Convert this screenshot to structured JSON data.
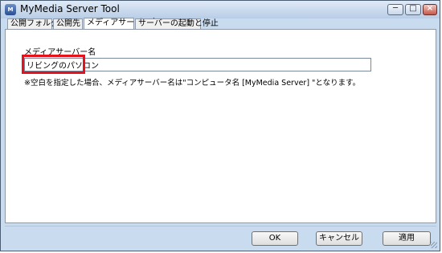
{
  "window": {
    "title": "MyMedia Server Tool",
    "icon": "app-icon",
    "controls": {
      "minimize": "─",
      "maximize": "□",
      "close": "×"
    }
  },
  "tabs": [
    {
      "label": "公開フォルダ",
      "active": false
    },
    {
      "label": "公開先",
      "active": false
    },
    {
      "label": "メディアサーバー名",
      "active": true
    },
    {
      "label": "サーバーの起動と停止",
      "active": false
    }
  ],
  "panel": {
    "section_label": "メディアサーバー名",
    "name_input_value": "リビングのパソコン",
    "note": "※空白を指定した場合、メディアサーバー名は\"コンピュータ名 [MyMedia Server] \"となります。"
  },
  "buttons": {
    "ok": "OK",
    "cancel": "キャンセル",
    "apply": "適用"
  },
  "colors": {
    "highlight_border": "#e8101a",
    "title_bar": "#c9dbef"
  }
}
